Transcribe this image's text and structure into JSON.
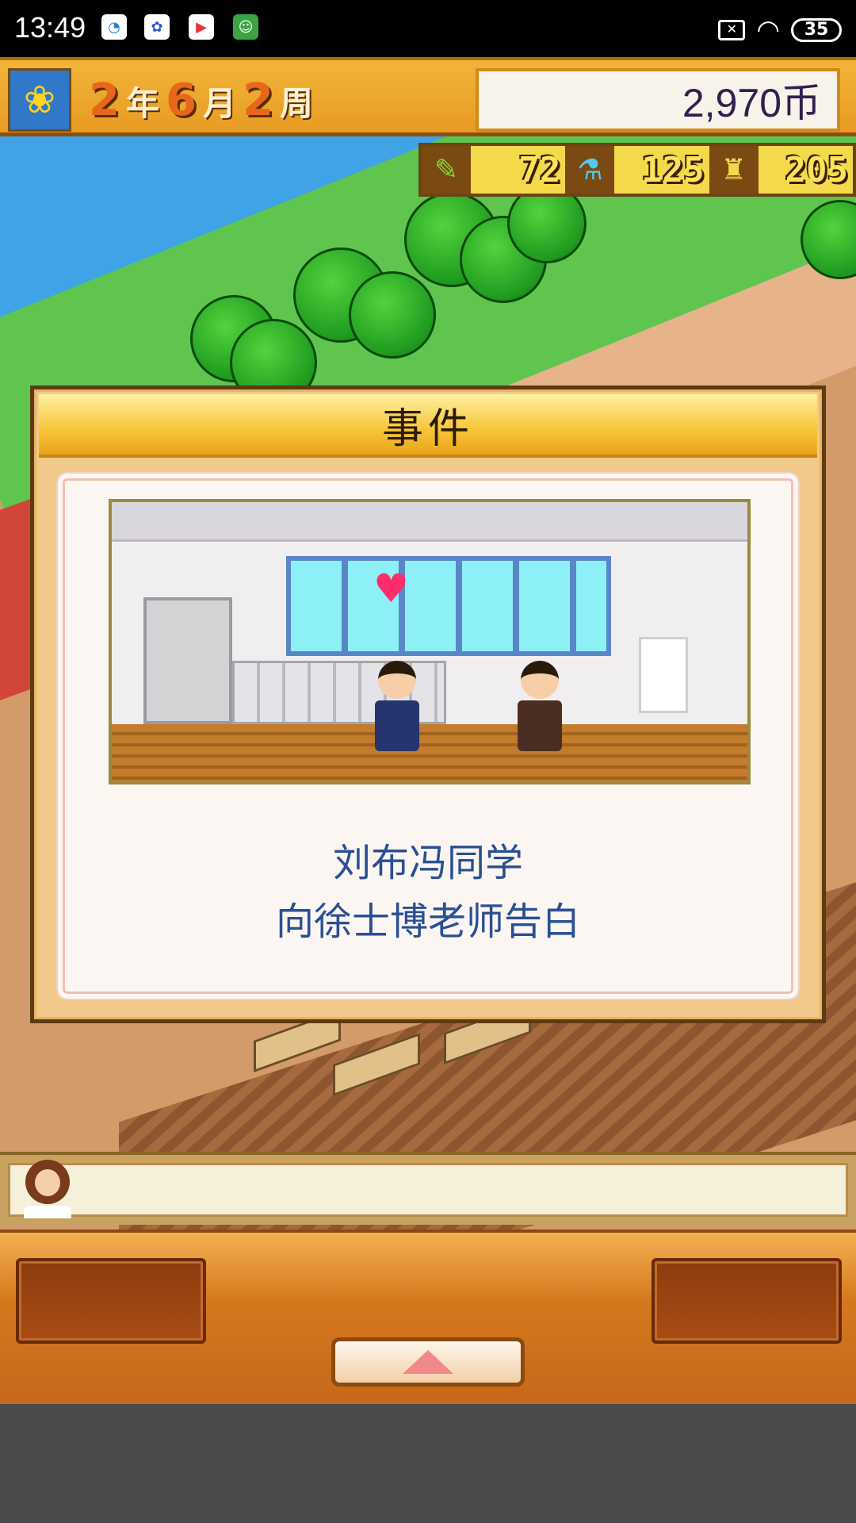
{
  "status_bar": {
    "time": "13:49",
    "battery": "35"
  },
  "header": {
    "date": {
      "year": "2",
      "year_unit": "年",
      "month": "6",
      "month_unit": "月",
      "week": "2",
      "week_unit": "周"
    },
    "money": "2,970币"
  },
  "resources": [
    {
      "icon": "pencil-icon",
      "value": "72"
    },
    {
      "icon": "flask-icon",
      "value": "125"
    },
    {
      "icon": "tower-icon",
      "value": "205"
    }
  ],
  "dialog": {
    "title": "事件",
    "line1": "刘布冯同学",
    "line2": "向徐士博老师告白"
  },
  "colors": {
    "header_orange": "#f2b53a",
    "event_text_blue": "#2a4f95",
    "heart_pink": "#ff2d6c"
  }
}
